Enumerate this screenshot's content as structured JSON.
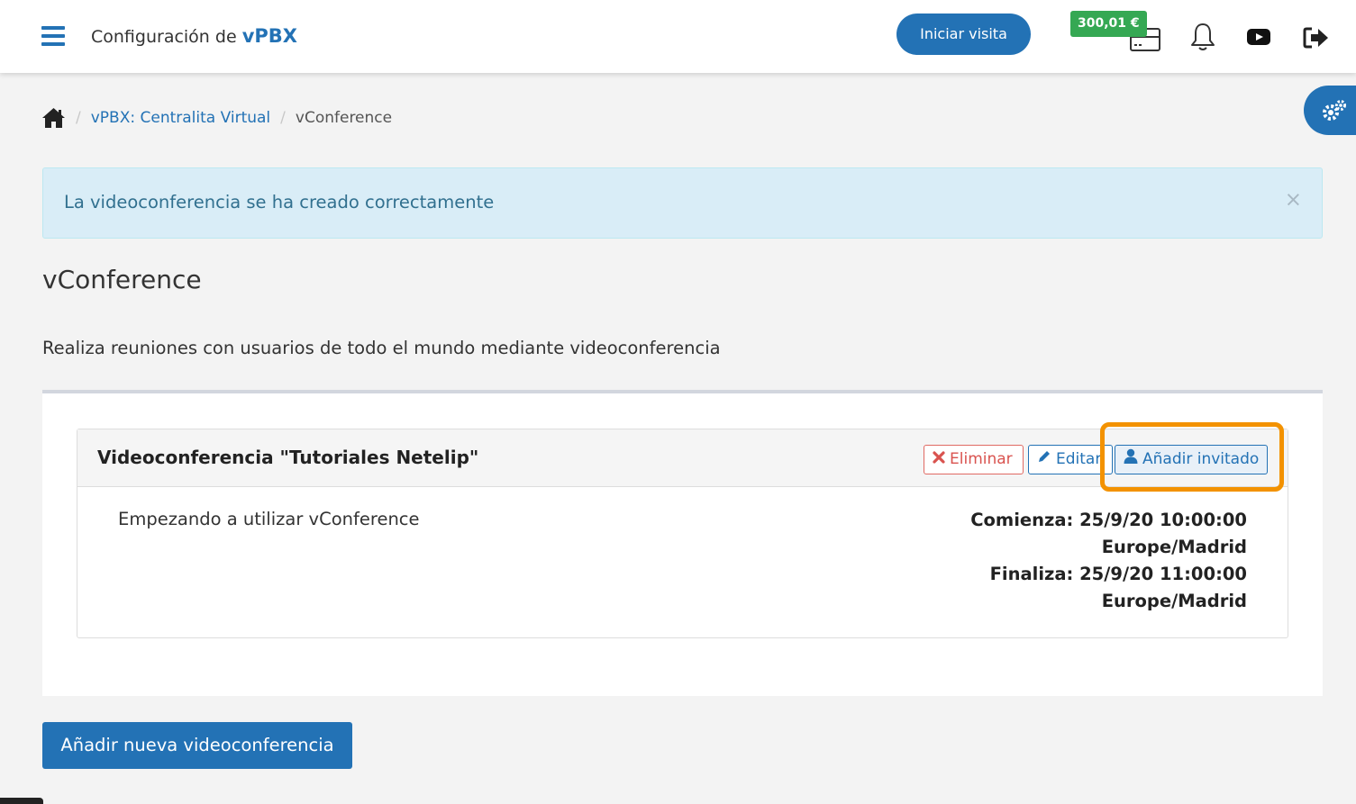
{
  "header": {
    "title_prefix": "Configuración de",
    "title_brand": "vPBX",
    "visit_button": "Iniciar visita",
    "balance": "300,01 €"
  },
  "breadcrumb": {
    "items": [
      "vPBX: Centralita Virtual",
      "vConference"
    ]
  },
  "alert": {
    "message": "La videoconferencia se ha creado correctamente",
    "close": "×"
  },
  "page": {
    "title": "vConference",
    "description": "Realiza reuniones con usuarios de todo el mundo mediante videoconferencia"
  },
  "conference": {
    "title": "Videoconferencia \"Tutoriales Netelip\"",
    "delete_label": "Eliminar",
    "edit_label": "Editar",
    "add_guest_label": "Añadir invitado",
    "description": "Empezando a utilizar vConference",
    "start_line": "Comienza: 25/9/20 10:00:00",
    "start_tz": "Europe/Madrid",
    "end_line": "Finaliza: 25/9/20 11:00:00",
    "end_tz": "Europe/Madrid"
  },
  "actions": {
    "new_conference": "Añadir nueva videoconferencia"
  },
  "colors": {
    "primary": "#2372b5",
    "balance_badge": "#35a853",
    "danger": "#d9534f",
    "highlight": "#f39200",
    "alert_bg": "#d9edf7"
  },
  "icons": [
    "menu-icon",
    "wallet-icon",
    "bell-icon",
    "youtube-icon",
    "logout-icon",
    "gears-icon",
    "home-icon",
    "times-icon",
    "pencil-icon",
    "user-icon"
  ]
}
